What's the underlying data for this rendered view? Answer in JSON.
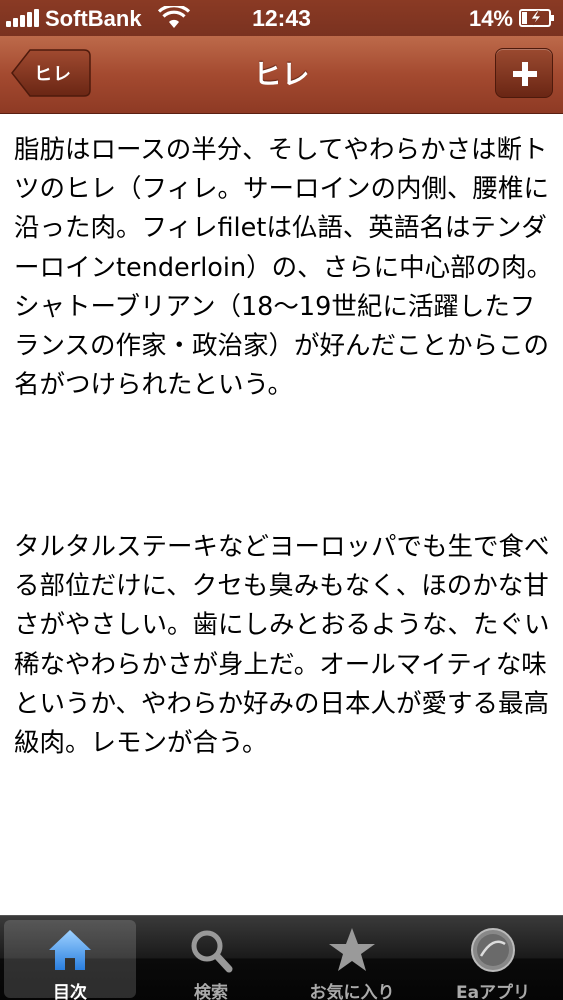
{
  "status_bar": {
    "carrier": "SoftBank",
    "time": "12:43",
    "battery_percent": "14%"
  },
  "nav_bar": {
    "back_label": "ヒレ",
    "title": "ヒレ",
    "add_icon": "plus-icon"
  },
  "content": {
    "paragraphs": [
      "脂肪はロースの半分、そしてやわらかさは断トツのヒレ（フィレ。サーロインの内側、腰椎に沿った肉。フィレfiletは仏語、英語名はテンダーロインtenderloin）の、さらに中心部の肉。シャトーブリアン（18〜19世紀に活躍したフランスの作家・政治家）が好んだことからこの名がつけられたという。",
      "タルタルステーキなどヨーロッパでも生で食べる部位だけに、クセも臭みもなく、ほのかな甘さがやさしい。歯にしみとおるような、たぐい稀なやわらかさが身上だ。オールマイティな味というか、やわらか好みの日本人が愛する最高級肉。レモンが合う。"
    ]
  },
  "tab_bar": {
    "tabs": [
      {
        "label": "目次",
        "icon": "home-icon",
        "selected": true
      },
      {
        "label": "検索",
        "icon": "search-icon",
        "selected": false
      },
      {
        "label": "お気に入り",
        "icon": "star-icon",
        "selected": false
      },
      {
        "label": "Eaアプリ",
        "icon": "ea-app-icon",
        "selected": false
      }
    ]
  }
}
